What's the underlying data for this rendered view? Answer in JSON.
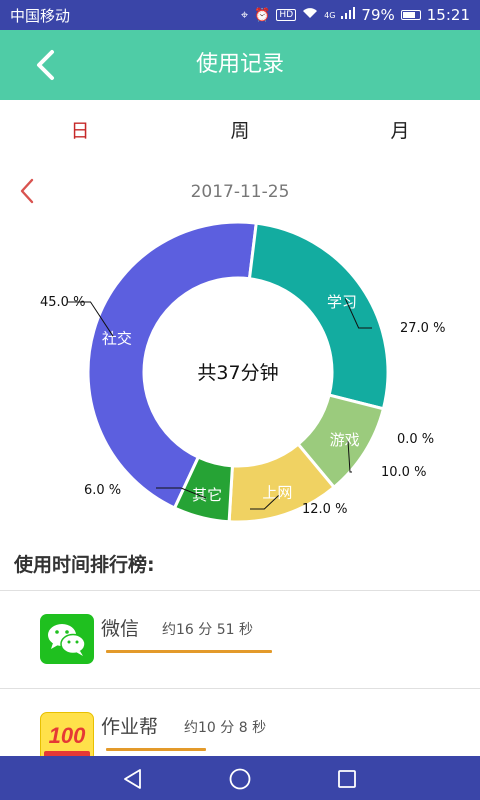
{
  "status": {
    "carrier": "中国移动",
    "network": "4G",
    "battery": "79%",
    "battery_level": 0.79,
    "time": "15:21"
  },
  "header": {
    "title": "使用记录"
  },
  "tabs": [
    {
      "label": "日",
      "active": true
    },
    {
      "label": "周",
      "active": false
    },
    {
      "label": "月",
      "active": false
    }
  ],
  "date": "2017-11-25",
  "chart_data": {
    "type": "pie",
    "style": "donut",
    "center_text": "共37分钟",
    "slices": [
      {
        "label": "社交",
        "value": 45.0,
        "pct_label": "45.0 %",
        "color": "#5c5fdf"
      },
      {
        "label": "学习",
        "value": 27.0,
        "pct_label": "27.0 %",
        "color": "#13aca0"
      },
      {
        "label": "",
        "value": 0.0,
        "pct_label": "0.0 %",
        "color": "#13aca0"
      },
      {
        "label": "游戏",
        "value": 10.0,
        "pct_label": "10.0 %",
        "color": "#9bcb7d"
      },
      {
        "label": "上网",
        "value": 12.0,
        "pct_label": "12.0 %",
        "color": "#f0d262"
      },
      {
        "label": "其它",
        "value": 6.0,
        "pct_label": "6.0 %",
        "color": "#26a335"
      }
    ]
  },
  "ranking": {
    "title": "使用时间排行榜:",
    "items": [
      {
        "name": "微信",
        "time": "约16 分 51 秒",
        "fraction": 1.0,
        "icon": "wechat-icon"
      },
      {
        "name": "作业帮",
        "time": "约10 分 8 秒",
        "fraction": 0.6,
        "icon": "zuoyebang-icon",
        "icon_text": "100"
      }
    ]
  },
  "colors": {
    "accent": "#4fcca6",
    "status_bar": "#3a45a8",
    "active_tab": "#c62828",
    "bar": "#e39a2a"
  }
}
